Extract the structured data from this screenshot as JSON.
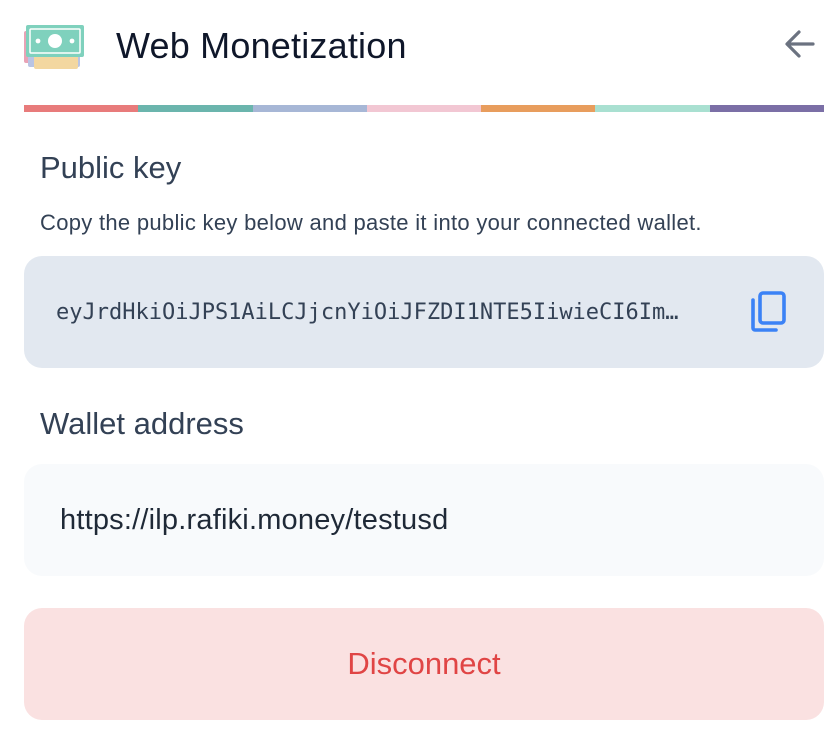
{
  "header": {
    "title": "Web Monetization",
    "logo_icon": "money-bill-icon",
    "back_icon": "arrow-left-icon"
  },
  "stripe_colors": [
    "#e87b7b",
    "#6bb5ad",
    "#a7b7d6",
    "#f2c7d3",
    "#e89d5d",
    "#a9e0d1",
    "#7b6fa6"
  ],
  "public_key": {
    "heading": "Public key",
    "description": "Copy the public key below and paste it into your connected wallet.",
    "value": "eyJrdHkiOiJPS1AiLCJjcnYiOiJFZDI1NTE5IiwieCI6Im…",
    "copy_icon": "copy-icon"
  },
  "wallet": {
    "heading": "Wallet address",
    "address": "https://ilp.rafiki.money/testusd"
  },
  "actions": {
    "disconnect_label": "Disconnect"
  },
  "colors": {
    "accent_blue": "#3b82f6",
    "danger_text": "#e04545",
    "danger_bg": "#fae1e1"
  }
}
